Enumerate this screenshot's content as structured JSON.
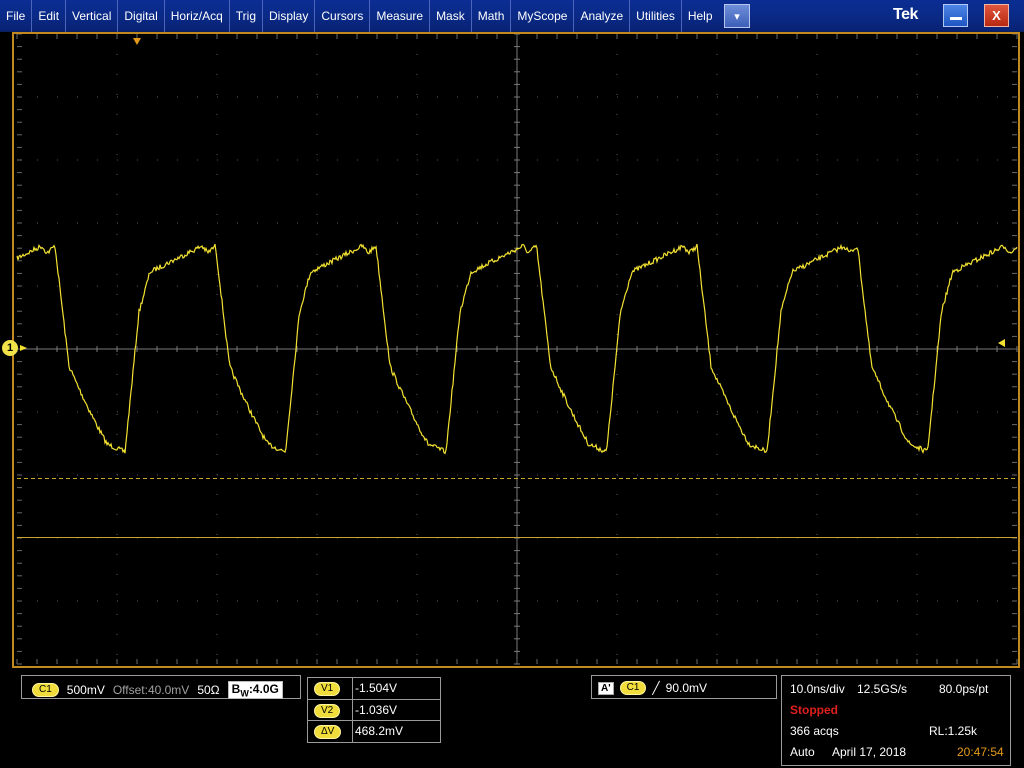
{
  "menu": {
    "items": [
      "File",
      "Edit",
      "Vertical",
      "Digital",
      "Horiz/Acq",
      "Trig",
      "Display",
      "Cursors",
      "Measure",
      "Mask",
      "Math",
      "MyScope",
      "Analyze",
      "Utilities",
      "Help"
    ],
    "dropdown_glyph": "▾",
    "brand": "Tek",
    "minimize_icon": "minimize-icon",
    "close_glyph": "X"
  },
  "waveform": {
    "channel_marker": "1",
    "trace_color": "#f3e232",
    "graticule_color": "#5a5a5a",
    "cursor_color": "#c9a52c"
  },
  "channel": {
    "badge": "C1",
    "scale": "500mV",
    "offset": "Offset:40.0mV",
    "impedance": "50Ω",
    "bw_prefix": "B",
    "bw_sub": "W",
    "bw_value": ":4.0G"
  },
  "cursors": {
    "rows": [
      {
        "label": "V1",
        "value": "-1.504V"
      },
      {
        "label": "V2",
        "value": "-1.036V"
      },
      {
        "label": "ΔV",
        "value": "468.2mV"
      }
    ]
  },
  "trigger": {
    "mode_badge": "A'",
    "source": "C1",
    "slope_glyph": "╱",
    "level": "90.0mV"
  },
  "acquisition": {
    "timebase": "10.0ns/div",
    "sample_rate": "12.5GS/s",
    "resolution": "80.0ps/pt",
    "state": "Stopped",
    "acqs": "366 acqs",
    "record_length": "RL:1.25k",
    "mode": "Auto",
    "date": "April 17, 2018",
    "time": "20:47:54"
  }
}
